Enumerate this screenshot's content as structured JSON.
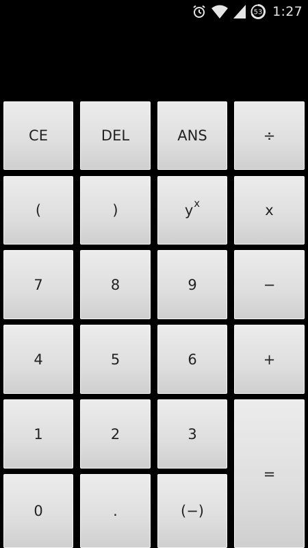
{
  "status_bar": {
    "battery_level": "53",
    "time": "1:27",
    "icons": [
      "alarm-clock-icon",
      "wifi-icon",
      "cell-signal-icon",
      "battery-icon"
    ]
  },
  "display": {
    "expression": "",
    "result": ""
  },
  "keypad": {
    "ce": "CE",
    "del": "DEL",
    "ans": "ANS",
    "divide": "÷",
    "open_paren": "(",
    "close_paren": ")",
    "power_base": "y",
    "power_exp": "x",
    "multiply": "x",
    "seven": "7",
    "eight": "8",
    "nine": "9",
    "minus": "−",
    "four": "4",
    "five": "5",
    "six": "6",
    "plus": "+",
    "one": "1",
    "two": "2",
    "three": "3",
    "equals": "=",
    "zero": "0",
    "decimal": ".",
    "negate": "(−)"
  },
  "colors": {
    "background": "#000000",
    "key_face": "#dedede",
    "key_text": "#222222",
    "status_icons": "#e6e6e6"
  }
}
